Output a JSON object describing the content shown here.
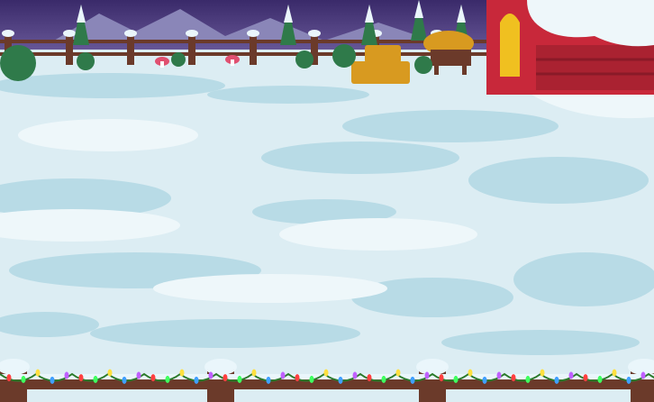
{
  "scene": {
    "type": "winter-farm-yard",
    "colors": {
      "sky": "#3a2a6a",
      "sky_light": "#6a5a9a",
      "mountains": "#8a86b8",
      "snow_ground": "#dcedf3",
      "snow_shadow": "#b8dbe6",
      "snow_highlight": "#eef7fa",
      "fence_wood": "#6b3a2a",
      "fence_snow": "#eaf6fb",
      "barn_red": "#c8283a",
      "barn_door": "#f0c020",
      "hay": "#d89a20",
      "tree": "#2f7a4a",
      "light_colors": [
        "#ff4040",
        "#40ff60",
        "#ffe040",
        "#40a0ff",
        "#c060ff"
      ]
    },
    "objects": [
      "background-fence",
      "hay-bales",
      "wooden-cart",
      "barn",
      "mushrooms",
      "bushes",
      "foreground-fence",
      "christmas-lights"
    ]
  }
}
